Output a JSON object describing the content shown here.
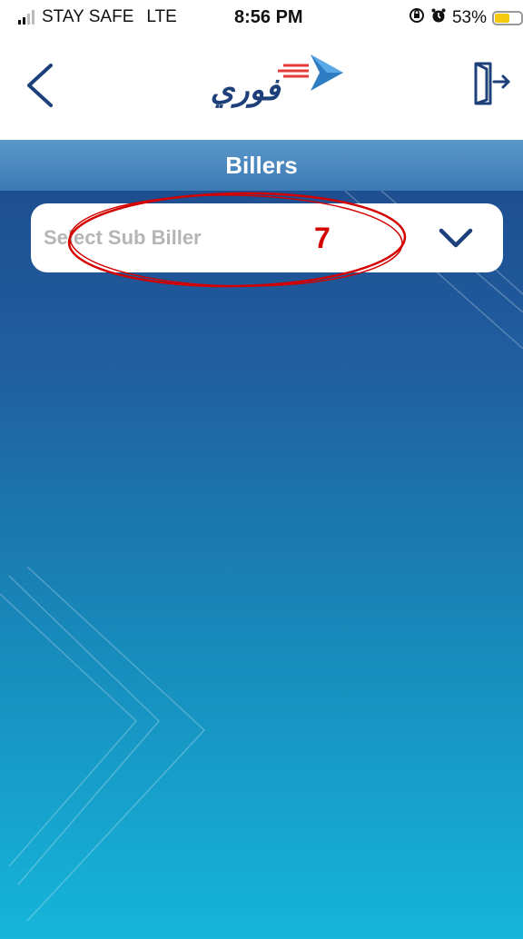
{
  "status_bar": {
    "carrier": "STAY SAFE",
    "network": "LTE",
    "time": "8:56 PM",
    "battery_percent": "53%",
    "icons": [
      "signal-icon",
      "rotation-lock-icon",
      "alarm-icon",
      "battery-icon"
    ]
  },
  "nav": {
    "logo_text": "فوري",
    "back_icon": "chevron-left-icon",
    "exit_icon": "logout-icon"
  },
  "page": {
    "title": "Billers"
  },
  "sub_biller_select": {
    "placeholder": "Select Sub Biller",
    "annotation_number": "7",
    "dropdown_icon": "chevron-down-icon"
  },
  "colors": {
    "accent_dark_blue": "#1d3f7a",
    "header_strip": "#4d89c0",
    "annotation_red": "#d40000",
    "logo_red": "#e83a3a"
  }
}
